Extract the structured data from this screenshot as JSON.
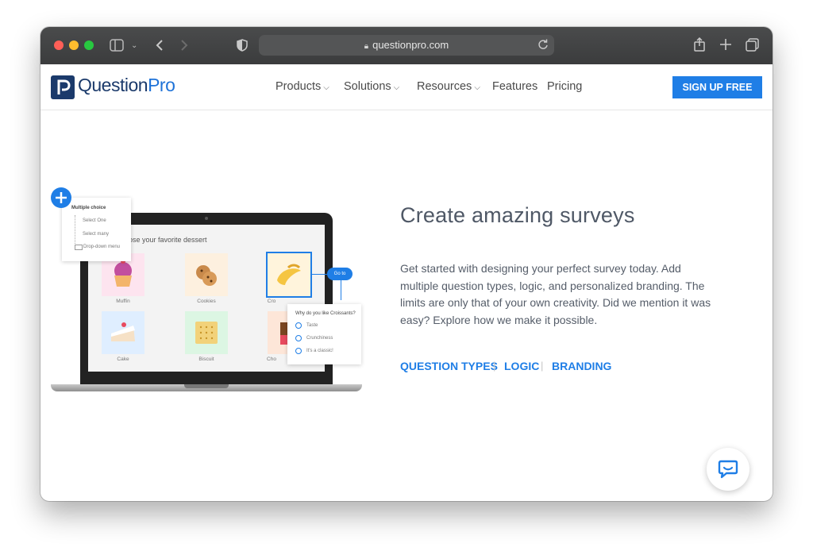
{
  "browser": {
    "url": "questionpro.com",
    "traffic_lights": {
      "close": "#ff5f57",
      "minimize": "#febc2e",
      "zoom": "#28c840"
    }
  },
  "header": {
    "logo_q": "QuestionPro",
    "logo_main": "Question",
    "logo_accent": "Pro",
    "nav": [
      {
        "label": "Products",
        "dropdown": true
      },
      {
        "label": "Solutions",
        "dropdown": true
      },
      {
        "label": "Resources",
        "dropdown": true
      },
      {
        "label": "Features",
        "dropdown": false
      },
      {
        "label": "Pricing",
        "dropdown": false
      }
    ],
    "signup_label": "SIGN UP FREE",
    "accent_color": "#1f7ee6"
  },
  "illustration": {
    "question_title": "oose your favorite dessert",
    "tiles": [
      "Muffin",
      "Cookies",
      "Cro",
      "Cake",
      "Biscuit",
      "Cho"
    ],
    "menu_title": "Multiple choice",
    "menu_items": [
      "Select One",
      "Select many",
      "Drop-down menu"
    ],
    "goto_label": "Go to",
    "followup_question": "Why do you like Croissants?",
    "followup_options": [
      "Taste",
      "Crunchiness",
      "It's a classic!"
    ]
  },
  "hero": {
    "title": "Create amazing surveys",
    "description": "Get started with designing your perfect survey today. Add multiple question types, logic, and personalized branding. The limits are only that of your own creativity. Did we mention it was easy? Explore how we make it possible.",
    "links": [
      "QUESTION TYPES",
      "LOGIC",
      "BRANDING"
    ]
  },
  "icons": {
    "sidebar": "sidebar-icon",
    "back": "chevron-left-icon",
    "forward": "chevron-right-icon",
    "shield": "shield-icon",
    "lock": "lock-icon",
    "reload": "reload-icon",
    "share": "share-icon",
    "new_tab": "plus-icon",
    "tabs": "tabs-overview-icon",
    "chat": "chat-bubble-icon"
  }
}
